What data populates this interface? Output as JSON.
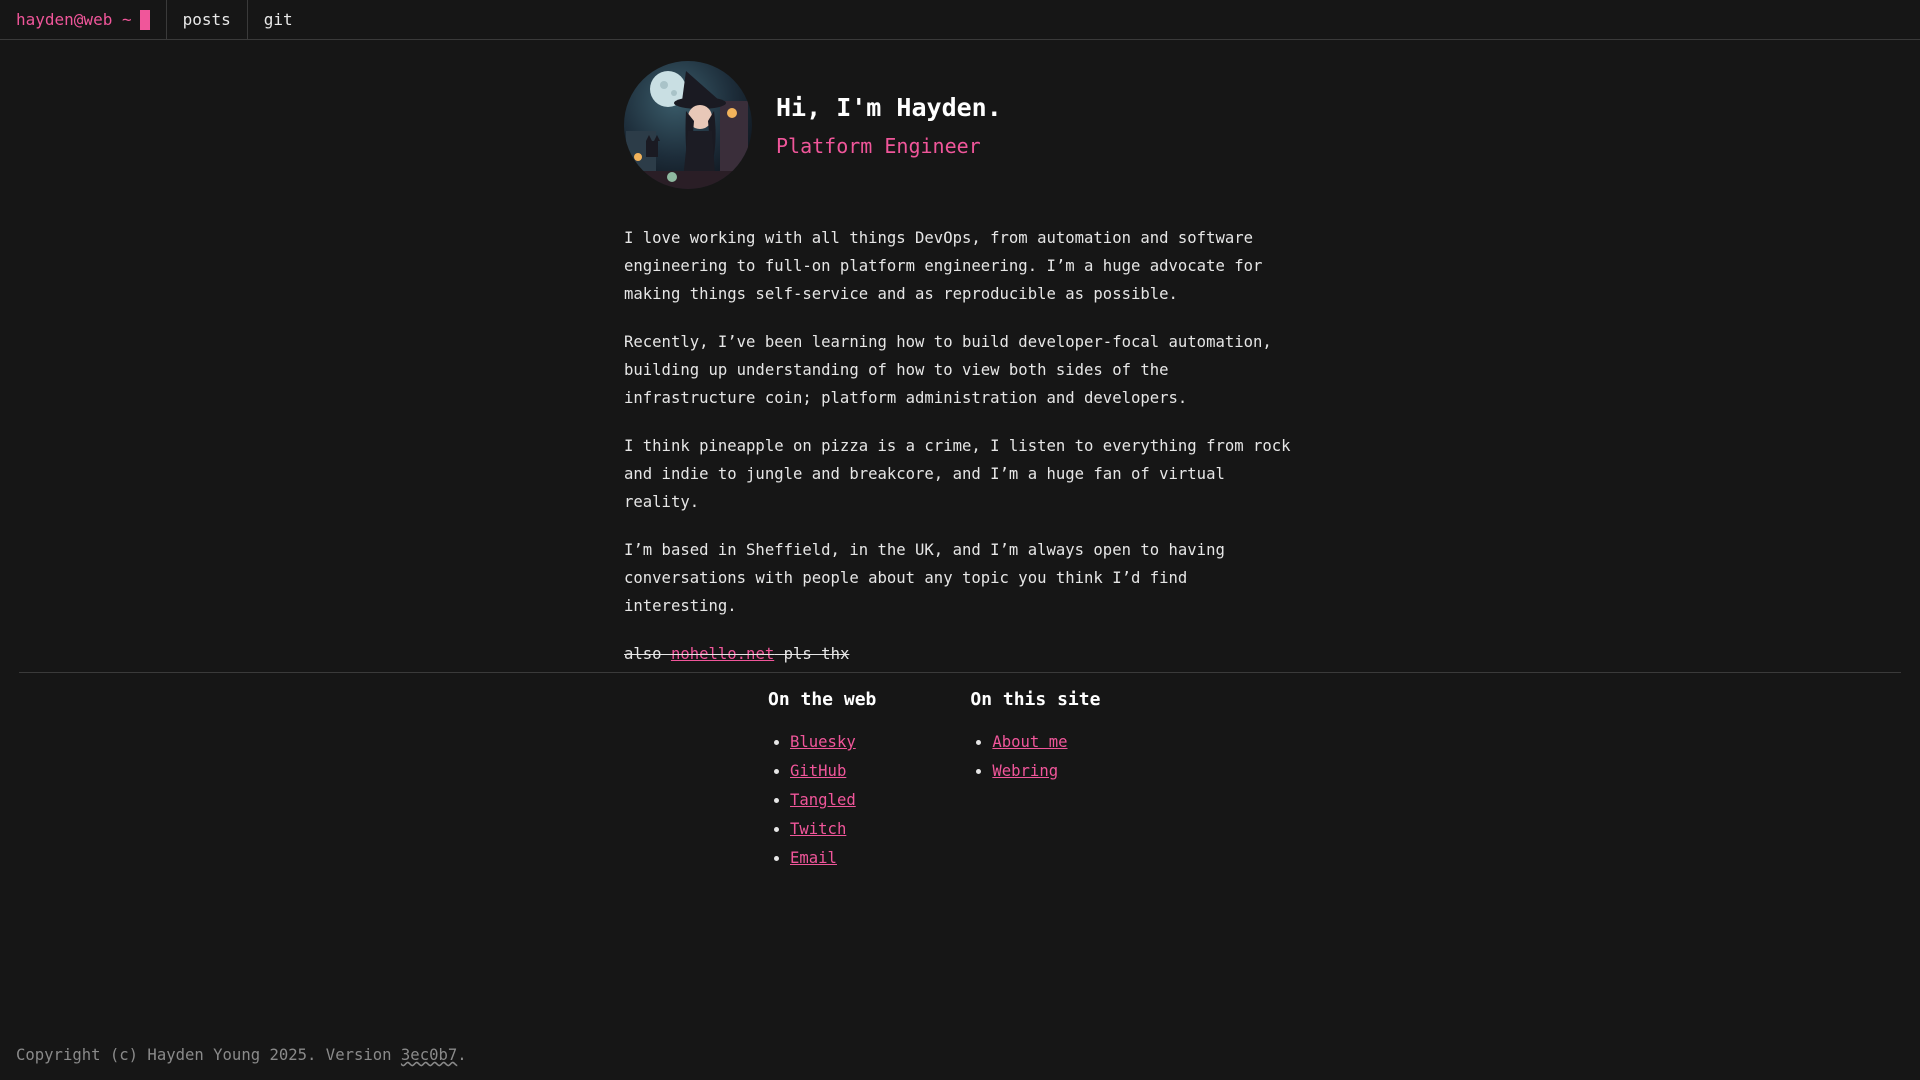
{
  "nav": {
    "brand": "hayden@web ~",
    "links": [
      "posts",
      "git"
    ]
  },
  "hero": {
    "title": "Hi, I'm Hayden.",
    "subtitle": "Platform Engineer",
    "avatar_icon": "witch-avatar"
  },
  "about": {
    "paragraphs": [
      "I love working with all things DevOps, from automation and software engineering to full-on platform engineering. I’m a huge advocate for making things self-service and as reproducible as possible.",
      "Recently, I’ve been learning how to build developer-focal automation, building up understanding of how to view both sides of the infrastructure coin; platform administration and developers.",
      "I think pineapple on pizza is a crime, I listen to everything from rock and indie to jungle and breakcore, and I’m a huge fan of virtual reality.",
      "I’m based in Sheffield, in the UK, and I’m always open to having conversations with people about any topic you think I’d find interesting."
    ],
    "aside_prefix": "also ",
    "aside_link": "nohello.net",
    "aside_suffix": " pls thx"
  },
  "footer": {
    "web": {
      "heading": "On the web",
      "links": [
        "Bluesky",
        "GitHub",
        "Tangled",
        "Twitch",
        "Email"
      ]
    },
    "site": {
      "heading": "On this site",
      "links": [
        "About me",
        "Webring"
      ]
    }
  },
  "copyright": {
    "prefix": "Copyright (c) Hayden Young 2025. Version ",
    "version": "3ec0b7",
    "suffix": "."
  },
  "colors": {
    "background": "#161616",
    "accent": "#f0569a",
    "text": "#e6e6e6",
    "muted": "#8a8a8a"
  }
}
